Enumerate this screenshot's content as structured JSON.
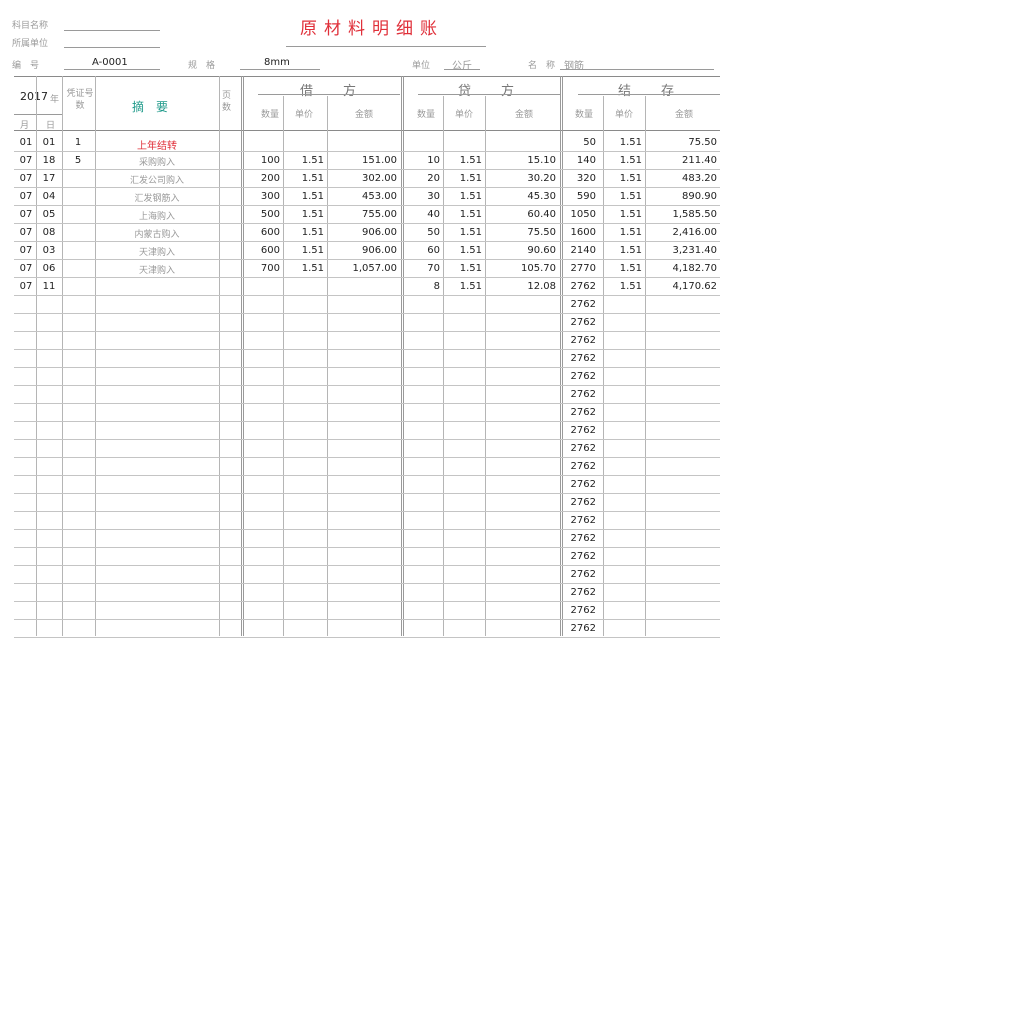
{
  "header": {
    "title": "原材料明细账",
    "top_label_1": "科目名称",
    "top_label_2": "所属单位",
    "code_label": "编　号",
    "code_value": "A-0001",
    "spec_label": "规　格",
    "spec_value": "8mm",
    "unit_label": "单位",
    "unit_value": "公斤",
    "name_label": "名　称",
    "name_value": "钢筋"
  },
  "table": {
    "year": "2017",
    "year_suffix": "年",
    "col_month": "月",
    "col_day": "日",
    "col_voucher": "凭证号数",
    "col_summary": "摘　要",
    "col_page": "页数",
    "debit_title": "借方",
    "credit_title": "贷方",
    "balance_title": "结存",
    "sub_qty": "数量",
    "sub_price": "单价",
    "sub_amount": "金额",
    "rows": [
      {
        "m": "01",
        "d": "01",
        "v": "1",
        "desc": "上年结转",
        "dq": "",
        "dp": "",
        "da": "",
        "cq": "",
        "cp": "",
        "ca": "",
        "bq": "50",
        "bp": "1.51",
        "ba": "75.50"
      },
      {
        "m": "07",
        "d": "18",
        "v": "5",
        "desc": "采购购入",
        "dq": "100",
        "dp": "1.51",
        "da": "151.00",
        "cq": "10",
        "cp": "1.51",
        "ca": "15.10",
        "bq": "140",
        "bp": "1.51",
        "ba": "211.40"
      },
      {
        "m": "07",
        "d": "17",
        "v": "",
        "desc": "汇发公司购入",
        "dq": "200",
        "dp": "1.51",
        "da": "302.00",
        "cq": "20",
        "cp": "1.51",
        "ca": "30.20",
        "bq": "320",
        "bp": "1.51",
        "ba": "483.20"
      },
      {
        "m": "07",
        "d": "04",
        "v": "",
        "desc": "汇发钢筋入",
        "dq": "300",
        "dp": "1.51",
        "da": "453.00",
        "cq": "30",
        "cp": "1.51",
        "ca": "45.30",
        "bq": "590",
        "bp": "1.51",
        "ba": "890.90"
      },
      {
        "m": "07",
        "d": "05",
        "v": "",
        "desc": "上海购入",
        "dq": "500",
        "dp": "1.51",
        "da": "755.00",
        "cq": "40",
        "cp": "1.51",
        "ca": "60.40",
        "bq": "1050",
        "bp": "1.51",
        "ba": "1,585.50"
      },
      {
        "m": "07",
        "d": "08",
        "v": "",
        "desc": "内蒙古购入",
        "dq": "600",
        "dp": "1.51",
        "da": "906.00",
        "cq": "50",
        "cp": "1.51",
        "ca": "75.50",
        "bq": "1600",
        "bp": "1.51",
        "ba": "2,416.00"
      },
      {
        "m": "07",
        "d": "03",
        "v": "",
        "desc": "天津购入",
        "dq": "600",
        "dp": "1.51",
        "da": "906.00",
        "cq": "60",
        "cp": "1.51",
        "ca": "90.60",
        "bq": "2140",
        "bp": "1.51",
        "ba": "3,231.40"
      },
      {
        "m": "07",
        "d": "06",
        "v": "",
        "desc": "天津购入",
        "dq": "700",
        "dp": "1.51",
        "da": "1,057.00",
        "cq": "70",
        "cp": "1.51",
        "ca": "105.70",
        "bq": "2770",
        "bp": "1.51",
        "ba": "4,182.70"
      },
      {
        "m": "07",
        "d": "11",
        "v": "",
        "desc": "",
        "dq": "",
        "dp": "",
        "da": "",
        "cq": "8",
        "cp": "1.51",
        "ca": "12.08",
        "bq": "2762",
        "bp": "1.51",
        "ba": "4,170.62"
      },
      {
        "m": "",
        "d": "",
        "v": "",
        "desc": "",
        "dq": "",
        "dp": "",
        "da": "",
        "cq": "",
        "cp": "",
        "ca": "",
        "bq": "2762",
        "bp": "",
        "ba": ""
      },
      {
        "m": "",
        "d": "",
        "v": "",
        "desc": "",
        "dq": "",
        "dp": "",
        "da": "",
        "cq": "",
        "cp": "",
        "ca": "",
        "bq": "2762",
        "bp": "",
        "ba": ""
      },
      {
        "m": "",
        "d": "",
        "v": "",
        "desc": "",
        "dq": "",
        "dp": "",
        "da": "",
        "cq": "",
        "cp": "",
        "ca": "",
        "bq": "2762",
        "bp": "",
        "ba": ""
      },
      {
        "m": "",
        "d": "",
        "v": "",
        "desc": "",
        "dq": "",
        "dp": "",
        "da": "",
        "cq": "",
        "cp": "",
        "ca": "",
        "bq": "2762",
        "bp": "",
        "ba": ""
      },
      {
        "m": "",
        "d": "",
        "v": "",
        "desc": "",
        "dq": "",
        "dp": "",
        "da": "",
        "cq": "",
        "cp": "",
        "ca": "",
        "bq": "2762",
        "bp": "",
        "ba": ""
      },
      {
        "m": "",
        "d": "",
        "v": "",
        "desc": "",
        "dq": "",
        "dp": "",
        "da": "",
        "cq": "",
        "cp": "",
        "ca": "",
        "bq": "2762",
        "bp": "",
        "ba": ""
      },
      {
        "m": "",
        "d": "",
        "v": "",
        "desc": "",
        "dq": "",
        "dp": "",
        "da": "",
        "cq": "",
        "cp": "",
        "ca": "",
        "bq": "2762",
        "bp": "",
        "ba": ""
      },
      {
        "m": "",
        "d": "",
        "v": "",
        "desc": "",
        "dq": "",
        "dp": "",
        "da": "",
        "cq": "",
        "cp": "",
        "ca": "",
        "bq": "2762",
        "bp": "",
        "ba": ""
      },
      {
        "m": "",
        "d": "",
        "v": "",
        "desc": "",
        "dq": "",
        "dp": "",
        "da": "",
        "cq": "",
        "cp": "",
        "ca": "",
        "bq": "2762",
        "bp": "",
        "ba": ""
      },
      {
        "m": "",
        "d": "",
        "v": "",
        "desc": "",
        "dq": "",
        "dp": "",
        "da": "",
        "cq": "",
        "cp": "",
        "ca": "",
        "bq": "2762",
        "bp": "",
        "ba": ""
      },
      {
        "m": "",
        "d": "",
        "v": "",
        "desc": "",
        "dq": "",
        "dp": "",
        "da": "",
        "cq": "",
        "cp": "",
        "ca": "",
        "bq": "2762",
        "bp": "",
        "ba": ""
      },
      {
        "m": "",
        "d": "",
        "v": "",
        "desc": "",
        "dq": "",
        "dp": "",
        "da": "",
        "cq": "",
        "cp": "",
        "ca": "",
        "bq": "2762",
        "bp": "",
        "ba": ""
      },
      {
        "m": "",
        "d": "",
        "v": "",
        "desc": "",
        "dq": "",
        "dp": "",
        "da": "",
        "cq": "",
        "cp": "",
        "ca": "",
        "bq": "2762",
        "bp": "",
        "ba": ""
      },
      {
        "m": "",
        "d": "",
        "v": "",
        "desc": "",
        "dq": "",
        "dp": "",
        "da": "",
        "cq": "",
        "cp": "",
        "ca": "",
        "bq": "2762",
        "bp": "",
        "ba": ""
      },
      {
        "m": "",
        "d": "",
        "v": "",
        "desc": "",
        "dq": "",
        "dp": "",
        "da": "",
        "cq": "",
        "cp": "",
        "ca": "",
        "bq": "2762",
        "bp": "",
        "ba": ""
      },
      {
        "m": "",
        "d": "",
        "v": "",
        "desc": "",
        "dq": "",
        "dp": "",
        "da": "",
        "cq": "",
        "cp": "",
        "ca": "",
        "bq": "2762",
        "bp": "",
        "ba": ""
      },
      {
        "m": "",
        "d": "",
        "v": "",
        "desc": "",
        "dq": "",
        "dp": "",
        "da": "",
        "cq": "",
        "cp": "",
        "ca": "",
        "bq": "2762",
        "bp": "",
        "ba": ""
      },
      {
        "m": "",
        "d": "",
        "v": "",
        "desc": "",
        "dq": "",
        "dp": "",
        "da": "",
        "cq": "",
        "cp": "",
        "ca": "",
        "bq": "2762",
        "bp": "",
        "ba": ""
      },
      {
        "m": "",
        "d": "",
        "v": "",
        "desc": "",
        "dq": "",
        "dp": "",
        "da": "",
        "cq": "",
        "cp": "",
        "ca": "",
        "bq": "2762",
        "bp": "",
        "ba": ""
      }
    ]
  }
}
